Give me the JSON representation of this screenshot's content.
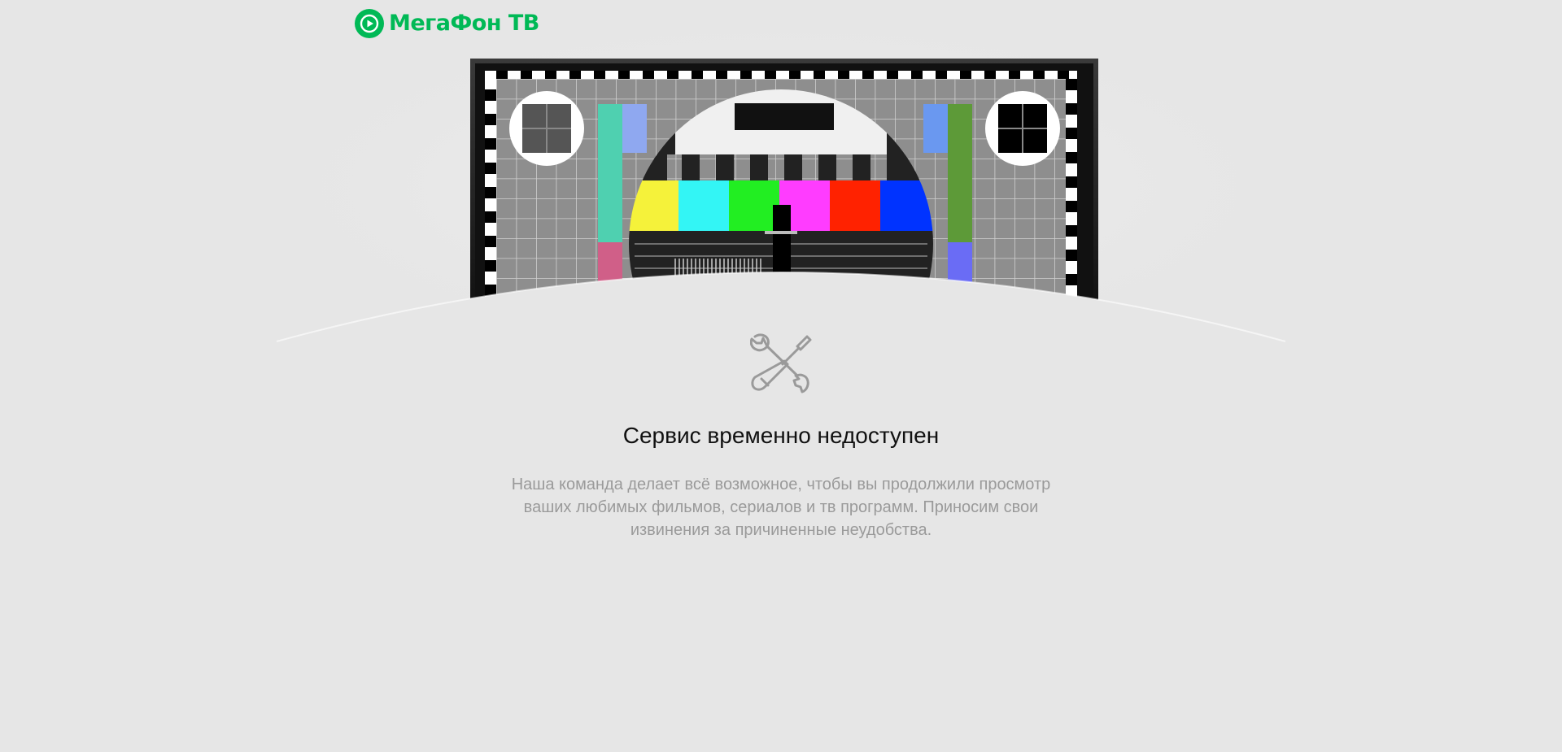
{
  "header": {
    "logo_text": "МегаФон ТВ",
    "logo_icon": "play-circle-icon",
    "brand_color": "#00b956"
  },
  "hero": {
    "image": "tv-test-pattern",
    "bar_colors": [
      "#f5f23a",
      "#33f5f5",
      "#22ee22",
      "#ff3cff",
      "#ff2200",
      "#0033ff"
    ]
  },
  "status": {
    "icon": "tools-icon",
    "title": "Сервис временно недоступен",
    "description": "Наша команда делает всё возможное, чтобы вы продолжили просмотр ваших любимых фильмов, сериалов и тв программ. Приносим свои извинения за причиненные неудобства."
  }
}
